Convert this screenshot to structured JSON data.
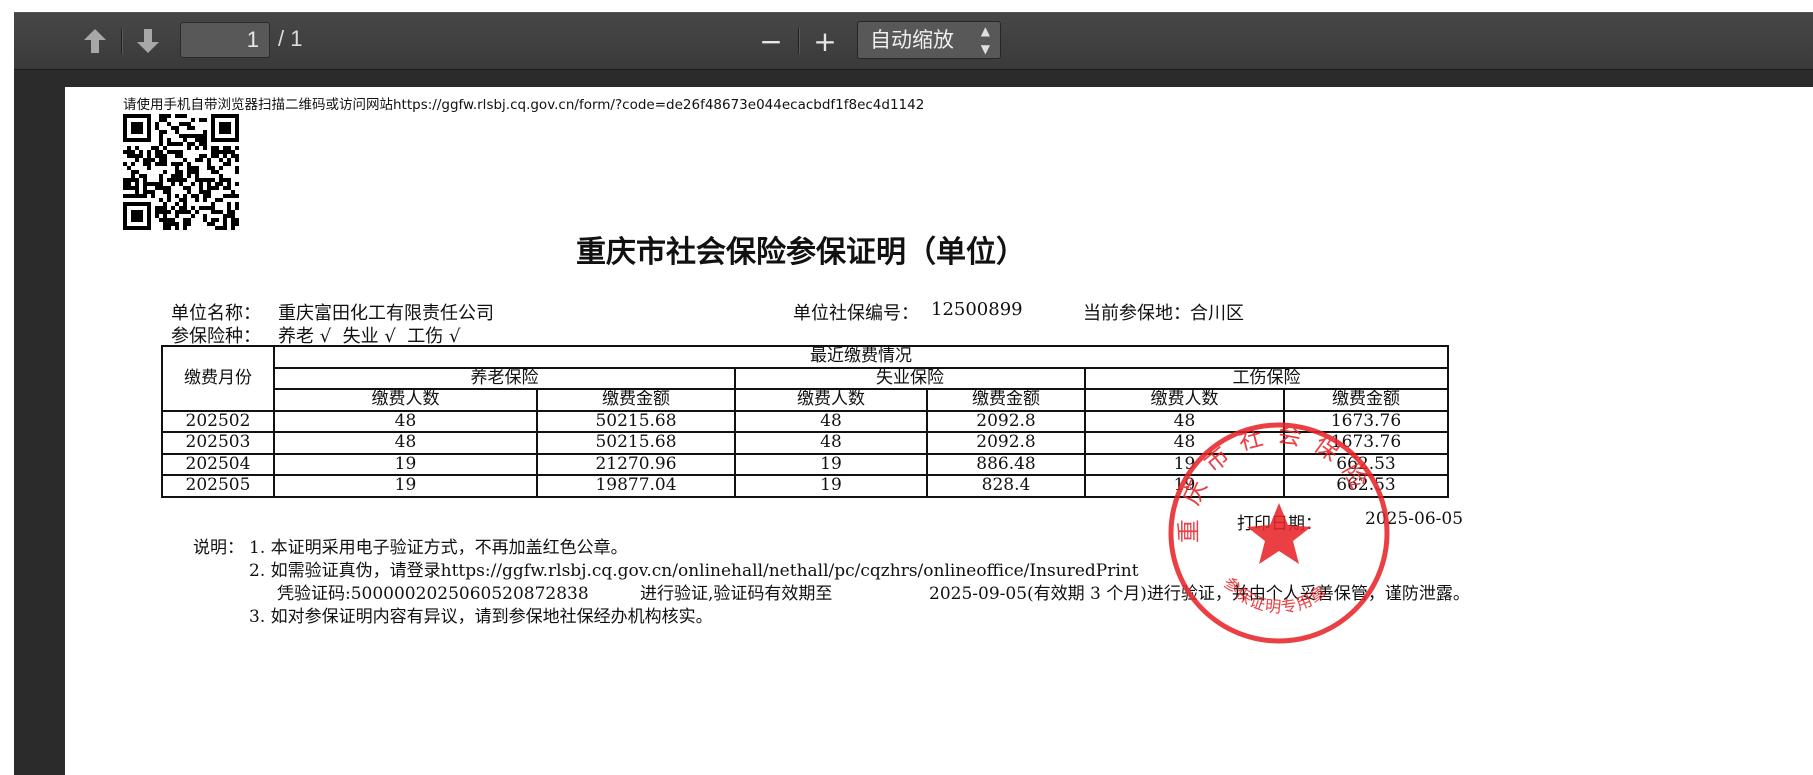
{
  "toolbar": {
    "prev_page_icon": "arrow-up-icon",
    "next_page_icon": "arrow-down-icon",
    "page_number": "1",
    "page_count": "/ 1",
    "zoom_out_label": "−",
    "zoom_in_label": "+",
    "zoom_select_value": "自动缩放"
  },
  "document": {
    "qr_instruction": "请使用手机自带浏览器扫描二维码或访问网站https://ggfw.rlsbj.cq.gov.cn/form/?code=de26f48673e044ecacbdf1f8ec4d1142",
    "title": "重庆市社会保险参保证明（单位）",
    "unit_name_label": "单位名称：",
    "unit_name_value": "重庆富田化工有限责任公司",
    "unit_code_label": "单位社保编号：",
    "unit_code_value": "12500899",
    "location_label": "当前参保地：",
    "location_value": "合川区",
    "insurance_types_label": "参保险种：",
    "insurance_types_value": "养老 √  失业 √  工伤 √",
    "table": {
      "month_header": "缴费月份",
      "recent_header": "最近缴费情况",
      "groups": [
        "养老保险",
        "失业保险",
        "工伤保险"
      ],
      "sub_headers": [
        "缴费人数",
        "缴费金额",
        "缴费人数",
        "缴费金额",
        "缴费人数",
        "缴费金额"
      ],
      "rows": [
        [
          "202502",
          "48",
          "50215.68",
          "48",
          "2092.8",
          "48",
          "1673.76"
        ],
        [
          "202503",
          "48",
          "50215.68",
          "48",
          "2092.8",
          "48",
          "1673.76"
        ],
        [
          "202504",
          "19",
          "21270.96",
          "19",
          "886.48",
          "19",
          "662.53"
        ],
        [
          "202505",
          "19",
          "19877.04",
          "19",
          "828.4",
          "19",
          "662.53"
        ]
      ]
    },
    "print_date_label": "打印日期：",
    "print_date_value": "2025-06-05",
    "notes_label": "说明：",
    "notes": [
      "1. 本证明采用电子验证方式，不再加盖红色公章。",
      "2. 如需验证真伪，请登录https://ggfw.rlsbj.cq.gov.cn/onlinehall/nethall/pc/cqzhrs/onlineoffice/InsuredPrint",
      "凭验证码:5000002025060520872838",
      "进行验证,验证码有效期至",
      "2025-09-05(有效期 3 个月)进行验证，并由个人妥善保管，谨防泄露。",
      "3. 如对参保证明内容有异议，请到参保地社保经办机构核实。"
    ],
    "stamp": {
      "top_text": "重庆市社会保险",
      "bottom_text": "参保证明专用章",
      "color": "#e8262b"
    }
  }
}
